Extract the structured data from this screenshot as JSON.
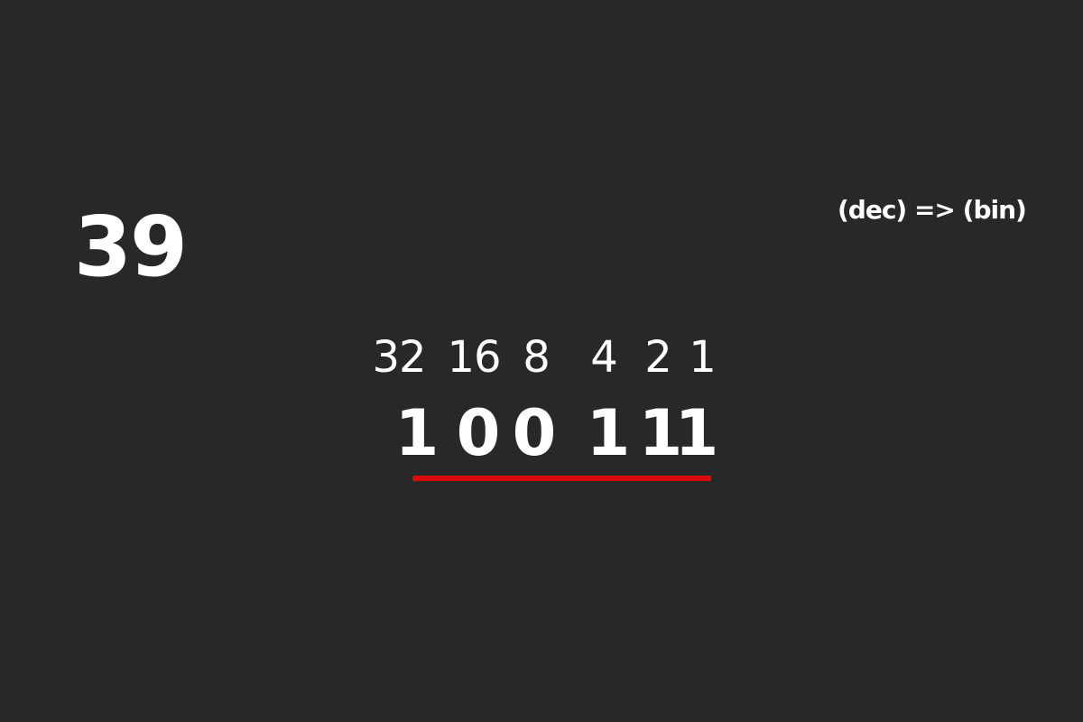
{
  "decimal_value": "39",
  "conversion_label": "(dec) => (bin)",
  "place_values": [
    "32",
    "16",
    "8",
    "4",
    "2",
    "1"
  ],
  "binary_digits": [
    "1",
    "0",
    "0",
    "1",
    "1",
    "1"
  ],
  "colors": {
    "background": "#282828",
    "text": "#ffffff",
    "underline": "#d90d0d"
  }
}
